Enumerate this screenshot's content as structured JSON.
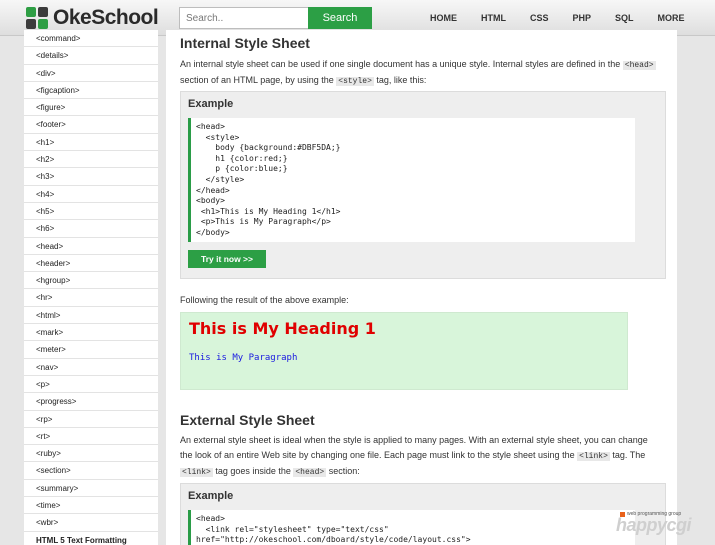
{
  "header": {
    "logo_text": "OkeSchool",
    "search_placeholder": "Search..",
    "search_button": "Search",
    "nav": [
      "HOME",
      "HTML",
      "CSS",
      "PHP",
      "SQL",
      "MORE"
    ]
  },
  "sidebar": {
    "items": [
      "<command>",
      "<details>",
      "<div>",
      "<figcaption>",
      "<figure>",
      "<footer>",
      "<h1>",
      "<h2>",
      "<h3>",
      "<h4>",
      "<h5>",
      "<h6>",
      "<head>",
      "<header>",
      "<hgroup>",
      "<hr>",
      "<html>",
      "<mark>",
      "<meter>",
      "<nav>",
      "<p>",
      "<progress>",
      "<rp>",
      "<rt>",
      "<ruby>",
      "<section>",
      "<summary>",
      "<time>",
      "<wbr>"
    ],
    "section_heading": "HTML 5 Text Formatting"
  },
  "main": {
    "internal": {
      "title": "Internal Style Sheet",
      "p1": "An internal style sheet can be used if one single document has a unique style. Internal styles are defined in the ",
      "code_head": "<head>",
      "p2": " section of an HTML page, by using the ",
      "code_style": "<style>",
      "p3": " tag, like this:"
    },
    "example1": {
      "title": "Example",
      "code": "<head>\n  <style>\n    body {background:#DBF5DA;}\n    h1 {color:red;}\n    p {color:blue;}\n  </style>\n</head>\n<body>\n <h1>This is My Heading 1</h1>\n <p>This is My Paragraph</p>\n</body>",
      "button": "Try it now >>"
    },
    "following": "Following the result of the above example:",
    "result": {
      "heading": "This is My Heading 1",
      "paragraph": "This is My Paragraph"
    },
    "external": {
      "title": "External Style Sheet",
      "p1": "An external style sheet is ideal when the style is applied to many pages. With an external style sheet, you can change the look of an entire Web site by changing one file. Each page must link to the style sheet using the ",
      "code_link": "<link>",
      "p2": " tag. The ",
      "code_link2": "<link>",
      "p3": " tag goes inside the ",
      "code_head": "<head>",
      "p4": " section:"
    },
    "example2": {
      "title": "Example",
      "code": "<head>\n  <link rel=\"stylesheet\" type=\"text/css\"\nhref=\"http://okeschool.com/dboard/style/code/layout.css\">"
    }
  },
  "watermark": {
    "small": "web programming group",
    "big": "happycgi"
  }
}
